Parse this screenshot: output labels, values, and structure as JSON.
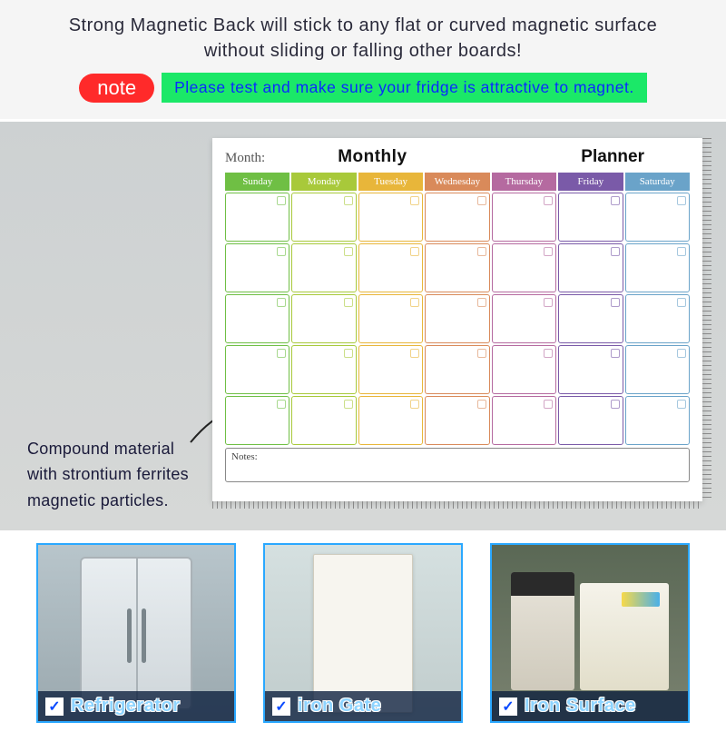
{
  "header": {
    "line": "Strong Magnetic Back will stick to any flat or curved magnetic surface without sliding or falling other boards!"
  },
  "note": {
    "label": "note",
    "message": "Please test and make sure your fridge is attractive to magnet."
  },
  "material": {
    "text": "Compound material with strontium ferrites magnetic particles."
  },
  "planner": {
    "month_label": "Month:",
    "title_a": "Monthly",
    "title_b": "Planner",
    "notes_label": "Notes:",
    "days": [
      {
        "name": "Sunday",
        "color": "#6fbf44"
      },
      {
        "name": "Monday",
        "color": "#a8c93a"
      },
      {
        "name": "Tuesday",
        "color": "#e8b63a"
      },
      {
        "name": "Wednesday",
        "color": "#d98a5a"
      },
      {
        "name": "Thursday",
        "color": "#b56aa0"
      },
      {
        "name": "Friday",
        "color": "#7a5aa8"
      },
      {
        "name": "Saturday",
        "color": "#6aa3c9"
      }
    ]
  },
  "cards": [
    {
      "label": "Refrigerator"
    },
    {
      "label": "iron Gate"
    },
    {
      "label": "Iron Surface"
    }
  ]
}
